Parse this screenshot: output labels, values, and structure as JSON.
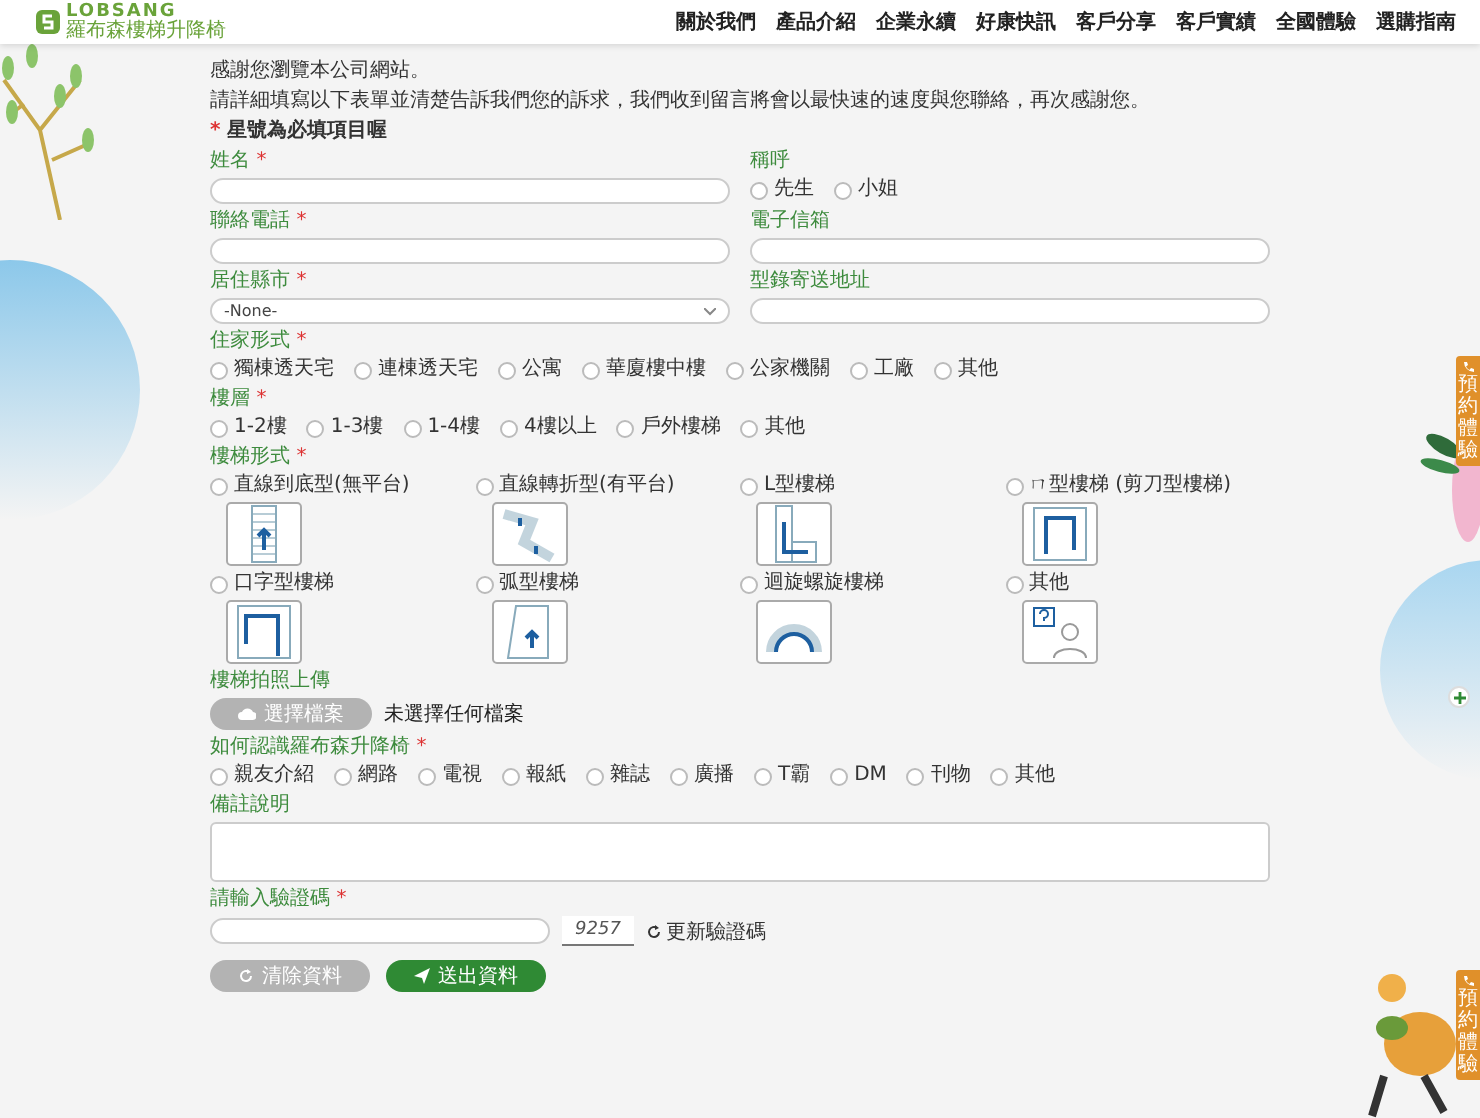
{
  "header": {
    "logo": {
      "name": "LOBSANG",
      "tagline": "羅布森樓梯升降椅"
    },
    "nav": [
      {
        "label": "關於我們"
      },
      {
        "label": "產品介紹"
      },
      {
        "label": "企業永續"
      },
      {
        "label": "好康快訊"
      },
      {
        "label": "客戶分享"
      },
      {
        "label": "客戶實績"
      },
      {
        "label": "全國體驗"
      },
      {
        "label": "選購指南"
      }
    ]
  },
  "intro": {
    "lines": [
      "感謝您瀏覽本公司網站。",
      "請詳細填寫以下表單並清楚告訴我們您的訴求，我們收到留言將會以最快速的速度與您聯絡，再次感謝您。"
    ],
    "note_mark": "*",
    "note": "星號為必填項目喔"
  },
  "form": {
    "rows": [
      {
        "cells": [
          {
            "kind": "text",
            "label": "姓名",
            "required_mark": "*"
          },
          {
            "kind": "radios",
            "label": "稱呼",
            "options": [
              {
                "label": "先生",
                "selected": false
              },
              {
                "label": "小姐",
                "selected": false
              }
            ]
          }
        ]
      },
      {
        "cells": [
          {
            "kind": "text",
            "label": "聯絡電話",
            "required_mark": "*"
          },
          {
            "kind": "text",
            "label": "電子信箱"
          }
        ]
      },
      {
        "cells": [
          {
            "kind": "select",
            "label": "居住縣市",
            "required_mark": "*",
            "value": "-None-"
          },
          {
            "kind": "text",
            "label": "型錄寄送地址"
          }
        ]
      },
      {
        "cells": [
          {
            "kind": "radios",
            "label": "住家形式",
            "required_mark": "*",
            "options": [
              {
                "label": "獨棟透天宅",
                "selected": false
              },
              {
                "label": "連棟透天宅",
                "selected": false
              },
              {
                "label": "公寓",
                "selected": false
              },
              {
                "label": "華廈樓中樓",
                "selected": false
              },
              {
                "label": "公家機關",
                "selected": false
              },
              {
                "label": "工廠",
                "selected": false
              },
              {
                "label": "其他",
                "selected": false
              }
            ]
          }
        ]
      },
      {
        "cells": [
          {
            "kind": "radios",
            "label": "樓層",
            "required_mark": "*",
            "options": [
              {
                "label": "1-2樓",
                "selected": false
              },
              {
                "label": "1-3樓",
                "selected": false
              },
              {
                "label": "1-4樓",
                "selected": false
              },
              {
                "label": "4樓以上",
                "selected": false
              },
              {
                "label": "戶外樓梯",
                "selected": false
              },
              {
                "label": "其他",
                "selected": false
              }
            ]
          }
        ]
      },
      {
        "cells": [
          {
            "kind": "stairs",
            "label": "樓梯形式",
            "required_mark": "*",
            "options": [
              {
                "label": "直線到底型(無平台)",
                "selected": false
              },
              {
                "label": "直線轉折型(有平台)",
                "selected": false
              },
              {
                "label": "L型樓梯",
                "selected": false
              },
              {
                "label": "ㄇ型樓梯 (剪刀型樓梯)",
                "selected": false
              },
              {
                "label": "口字型樓梯",
                "selected": false
              },
              {
                "label": "弧型樓梯",
                "selected": false
              },
              {
                "label": "迴旋螺旋樓梯",
                "selected": false
              },
              {
                "label": "其他",
                "selected": false
              }
            ]
          }
        ]
      },
      {
        "cells": [
          {
            "kind": "upload",
            "label": "樓梯拍照上傳",
            "button": "選擇檔案",
            "status": "未選擇任何檔案"
          }
        ]
      },
      {
        "cells": [
          {
            "kind": "radios",
            "label": "如何認識羅布森升降椅",
            "required_mark": "*",
            "options": [
              {
                "label": "親友介紹",
                "selected": false
              },
              {
                "label": "網路",
                "selected": false
              },
              {
                "label": "電視",
                "selected": false
              },
              {
                "label": "報紙",
                "selected": false
              },
              {
                "label": "雜誌",
                "selected": false
              },
              {
                "label": "廣播",
                "selected": false
              },
              {
                "label": "T霸",
                "selected": false
              },
              {
                "label": "DM",
                "selected": false
              },
              {
                "label": "刊物",
                "selected": false
              },
              {
                "label": "其他",
                "selected": false
              }
            ]
          }
        ]
      },
      {
        "cells": [
          {
            "kind": "textarea",
            "label": "備註說明"
          }
        ]
      },
      {
        "cells": [
          {
            "kind": "captcha",
            "label": "請輸入驗證碼",
            "required_mark": "*",
            "code": "9257",
            "refresh": "更新驗證碼"
          }
        ]
      }
    ]
  },
  "actions": [
    {
      "kind": "reset",
      "label": "清除資料"
    },
    {
      "kind": "submit",
      "label": "送出資料"
    }
  ],
  "side_tabs": [
    {
      "label": "預約體驗"
    },
    {
      "label": "預約體驗"
    }
  ]
}
